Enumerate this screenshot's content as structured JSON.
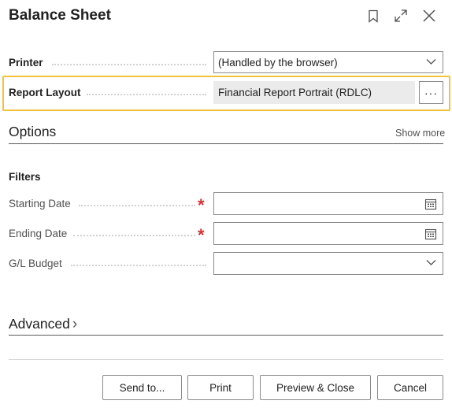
{
  "dialog": {
    "title": "Balance Sheet",
    "icons": [
      "bookmark-icon",
      "expand-icon",
      "close-icon"
    ]
  },
  "printer": {
    "label": "Printer",
    "value": "(Handled by the browser)"
  },
  "report_layout": {
    "label": "Report Layout",
    "value": "Financial Report Portrait (RDLC)",
    "button": "···"
  },
  "options": {
    "title": "Options",
    "show_more": "Show more"
  },
  "filters": {
    "title": "Filters",
    "fields": [
      {
        "label": "Starting Date",
        "value": "",
        "required_mark": "*"
      },
      {
        "label": "Ending Date",
        "value": "",
        "required_mark": "*"
      },
      {
        "label": "G/L Budget",
        "value": ""
      }
    ]
  },
  "advanced": {
    "title": "Advanced",
    "chevron": "›"
  },
  "footer": {
    "send_to": "Send to...",
    "print": "Print",
    "preview_close": "Preview & Close",
    "cancel": "Cancel"
  },
  "colors": {
    "focus_frame": "#f0c33c",
    "required": "#d13438"
  }
}
